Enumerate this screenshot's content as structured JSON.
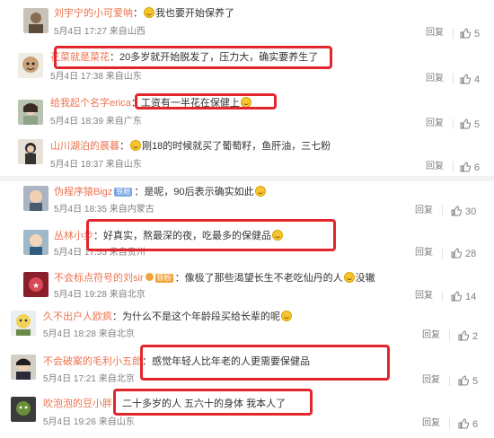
{
  "comments": [
    {
      "user": "刘宇宁的小可爱呐",
      "text": "我也要开始保养了",
      "time": "5月4日 17:27 来自山西",
      "reply": "回复",
      "likes": "5",
      "emoji_after_sep": true
    },
    {
      "user": "花菜就是菜花",
      "text": "20多岁就开始脱发了，压力大，确实要养生了",
      "time": "5月4日 17:38 来自山东",
      "reply": "回复",
      "likes": "4"
    },
    {
      "user": "给我起个名字erica",
      "text": "工资有一半花在保健上",
      "time": "5月4日 18:39 来自广东",
      "reply": "回复",
      "likes": "5",
      "emoji_end": true
    },
    {
      "user": "山川湖泊的晨暮",
      "text": "刚18的时候就买了葡萄籽，鱼肝油，三七粉",
      "time": "5月4日 18:37 来自山东",
      "reply": "回复",
      "likes": "6",
      "emoji_after_sep": true
    },
    {
      "user": "伪程序猿Bigz",
      "badge": "铁粉",
      "text": "是呢，90后表示确实如此",
      "time": "5月4日 18:35 来自内蒙古",
      "reply": "回复",
      "likes": "30",
      "emoji_end": true
    },
    {
      "user": "丛林小步",
      "text": "好真实，熬最深的夜，吃最多的保健品",
      "time": "5月4日 17:55 来自贵州",
      "reply": "回复",
      "likes": "28",
      "emoji_end": true
    },
    {
      "user": "不会标点符号的刘sir",
      "badge": "铁粉",
      "vip": true,
      "text": "像极了那些渴望长生不老吃仙丹的人",
      "text_tail": "没辙",
      "time": "5月4日 19:28 来自北京",
      "reply": "回复",
      "likes": "14",
      "emoji_mid": true
    },
    {
      "user": "久不出户人欧疯",
      "text": "为什么不是这个年龄段买给长辈的呢",
      "time": "5月4日 18:28 来自北京",
      "reply": "回复",
      "likes": "2",
      "emoji_end": true
    },
    {
      "user": "不会破案的毛利小五郎",
      "text": "感觉年轻人比年老的人更需要保健品",
      "time": "5月4日 17:21 来自北京",
      "reply": "回复",
      "likes": "5"
    },
    {
      "user": "吹泡泡的豆小胖",
      "text": "二十多岁的人 五六十的身体 我本人了",
      "time": "5月4日 19:26 来自山东",
      "reply": "回复",
      "likes": "6"
    }
  ],
  "icons": {
    "like": "thumbs-up-icon",
    "emoji": "smile-emoji-icon"
  },
  "colors": {
    "username": "#eb7350",
    "meta": "#808080",
    "highlight": "#e3262d",
    "background": "#ffffff",
    "divider": "#f2f2f2"
  }
}
